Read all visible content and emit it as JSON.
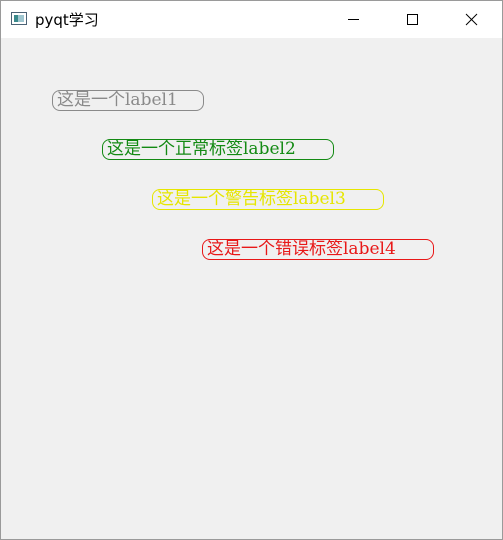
{
  "window": {
    "title": "pyqt学习",
    "icon": "app-window-icon"
  },
  "titlebar_controls": {
    "minimize_icon": "minimize-icon",
    "maximize_icon": "maximize-icon",
    "close_icon": "close-icon"
  },
  "labels": [
    {
      "text": "这是一个label1",
      "color": "#8a8a8a"
    },
    {
      "text": "这是一个正常标签label2",
      "color": "#138a13"
    },
    {
      "text": "这是一个警告标签label3",
      "color": "#e6e600"
    },
    {
      "text": "这是一个错误标签label4",
      "color": "#e81818"
    }
  ],
  "colors": {
    "content_background": "#f0f0f0",
    "titlebar_background": "#ffffff"
  }
}
